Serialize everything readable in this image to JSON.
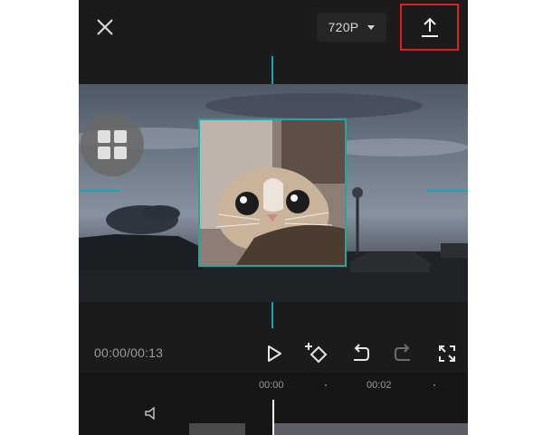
{
  "topbar": {
    "close_icon": "close-icon",
    "resolution": "720P",
    "resolution_caret_icon": "caret-down-icon",
    "export_icon": "upload-icon",
    "export_highlight_color": "#e02020"
  },
  "preview": {
    "guide_color": "#1aa3b5",
    "overlay_border_color": "#20a7a0",
    "grid_handle_icon": "grid-icon"
  },
  "controls": {
    "timecode": "00:00/00:13",
    "play_icon": "play-icon",
    "keyframe_icon": "keyframe-add-icon",
    "undo_icon": "undo-icon",
    "redo_icon": "redo-icon",
    "fullscreen_icon": "fullscreen-icon"
  },
  "timeline": {
    "ruler_labels": [
      "00:00",
      "00:02"
    ],
    "mute_icon": "speaker-icon"
  }
}
